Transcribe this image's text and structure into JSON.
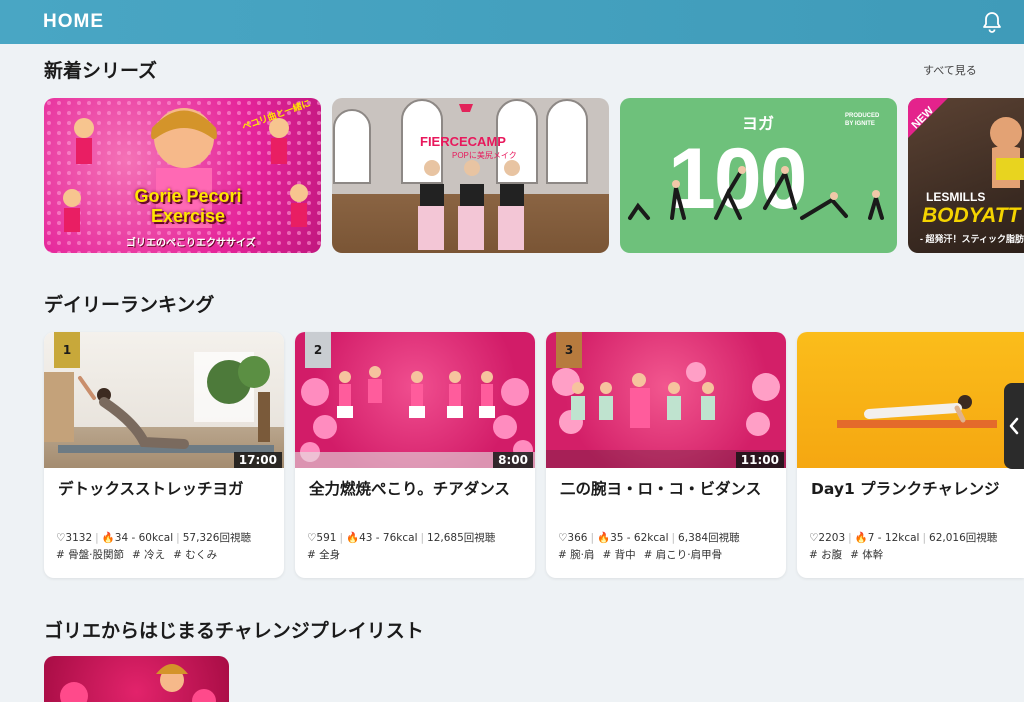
{
  "header": {
    "title": "HOME",
    "bell_icon": "bell-icon"
  },
  "new_series": {
    "title": "新着シリーズ",
    "see_all": "すべて見る",
    "cards": [
      {
        "main_text": "Gorie Pecori Exercise",
        "sub_text": "ゴリエのペこりエクササイズ",
        "top_text": "ペコリ曲と一緒に"
      },
      {
        "brand": "FIERCECAMP",
        "sub_text": "POPに美尻メイク"
      },
      {
        "label": "ヨガ",
        "number": "100",
        "producer": "PRODUCED BY IGNITE"
      },
      {
        "badge": "NEW",
        "brand": "LESMILLS",
        "title": "BODYATT",
        "sub_text": "- 超発汗！スティック脂肪"
      }
    ]
  },
  "ranking": {
    "title": "デイリーランキング",
    "items": [
      {
        "rank": "1",
        "duration": "17:00",
        "title": "デトックスストレッチヨガ",
        "likes": "♡3132",
        "kcal": "34 - 60kcal",
        "views": "57,326回視聴",
        "tags": [
          "# 骨盤·股関節",
          "# 冷え",
          "# むくみ"
        ]
      },
      {
        "rank": "2",
        "duration": "8:00",
        "title": "全力燃焼ぺこり。チアダンス",
        "likes": "♡591",
        "kcal": "43 - 76kcal",
        "views": "12,685回視聴",
        "tags": [
          "# 全身"
        ]
      },
      {
        "rank": "3",
        "duration": "11:00",
        "title": "二の腕ヨ・ロ・コ・ビダンス",
        "likes": "♡366",
        "kcal": "35 - 62kcal",
        "views": "6,384回視聴",
        "tags": [
          "# 腕·肩",
          "# 背中",
          "# 肩こり·肩甲骨"
        ]
      },
      {
        "rank": "",
        "duration": "",
        "title": "Day1 プランクチャレンジ",
        "likes": "♡2203",
        "kcal": "7 - 12kcal",
        "views": "62,016回視聴",
        "tags": [
          "# お腹",
          "# 体幹"
        ]
      }
    ]
  },
  "playlist": {
    "title": "ゴリエからはじまるチャレンジプレイリスト"
  },
  "colors": {
    "header": "#49a6c4",
    "gold": "#c8a83a",
    "silver": "#c9cdd1",
    "bronze": "#b77b3e"
  }
}
